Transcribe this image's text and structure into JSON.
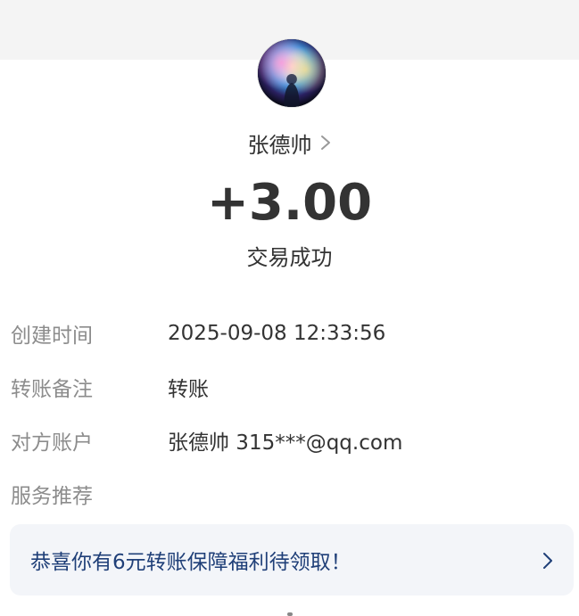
{
  "payer": {
    "name": "张德帅",
    "chevron_icon": "chevron-right-icon"
  },
  "amount": "+3.00",
  "status": "交易成功",
  "details": [
    {
      "label": "创建时间",
      "value": "2025-09-08 12:33:56"
    },
    {
      "label": "转账备注",
      "value": "转账"
    },
    {
      "label": "对方账户",
      "value": "张德帅 315***@qq.com"
    },
    {
      "label": "服务推荐",
      "value": ""
    }
  ],
  "promo": {
    "text": "恭喜你有6元转账保障福利待领取！",
    "chevron_icon": "chevron-right-icon"
  },
  "colors": {
    "top_band": "#f4f4f4",
    "label": "#8c8c8c",
    "text": "#333333",
    "promo_background": "#f3f5f9",
    "promo_text": "#1f3f78"
  }
}
